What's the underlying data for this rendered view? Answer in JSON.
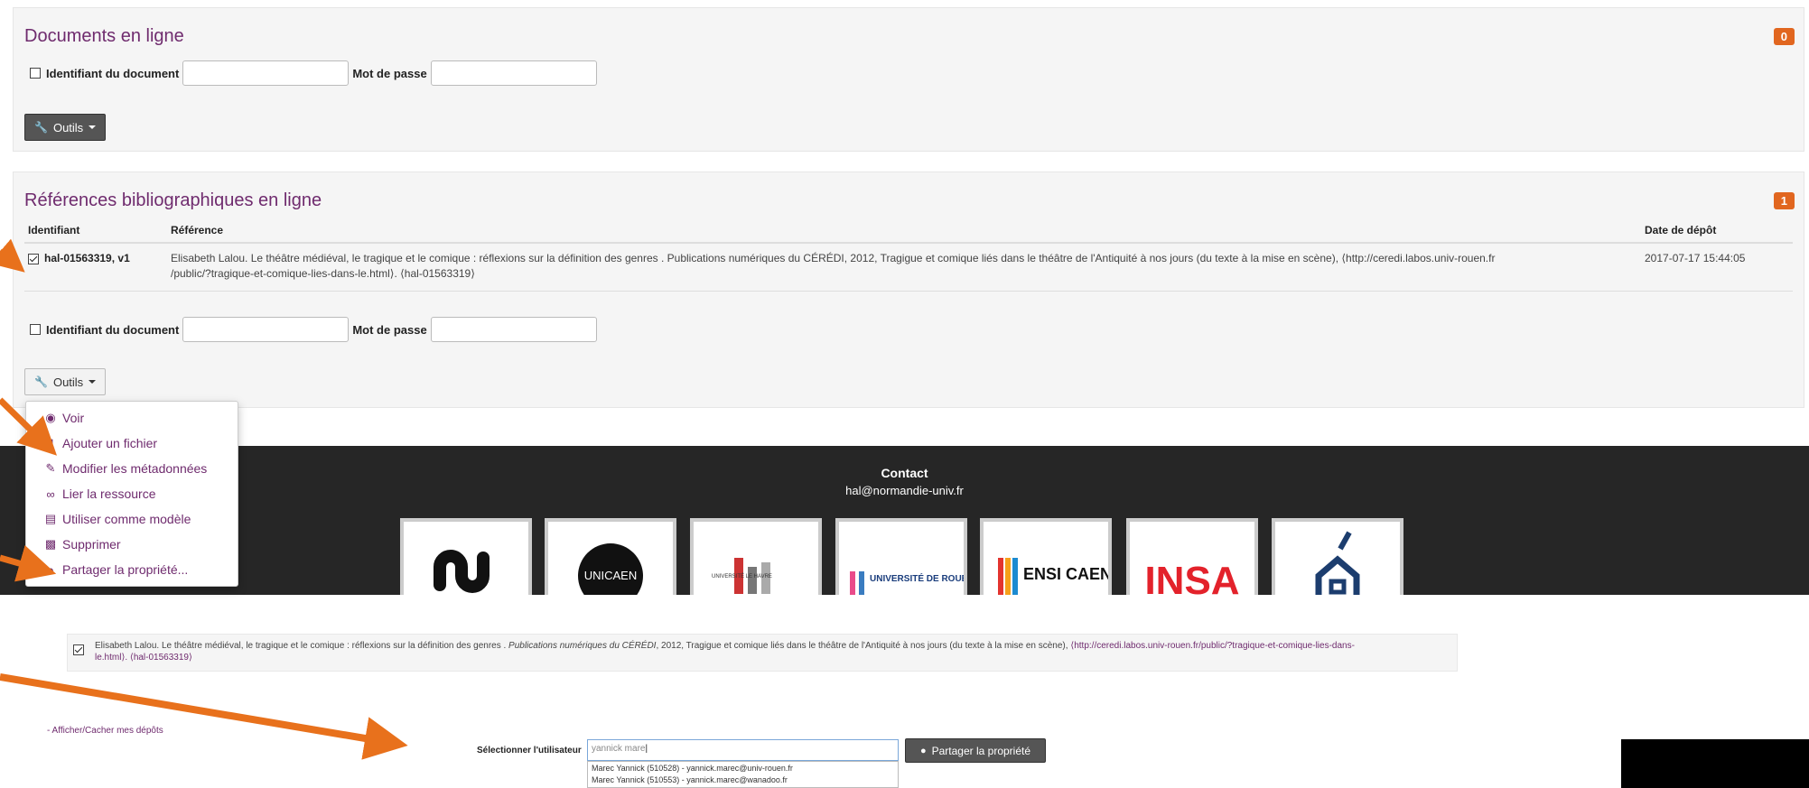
{
  "panel1": {
    "title": "Documents en ligne",
    "count": "0",
    "doc_id_label": "Identifiant du document",
    "password_label": "Mot de passe",
    "tools_label": "Outils"
  },
  "panel2": {
    "title": "Références bibliographiques en ligne",
    "count": "1",
    "columns": [
      "Identifiant",
      "Référence",
      "Date de dépôt"
    ],
    "row": {
      "id": "hal-01563319, v1",
      "reference_line1": "Elisabeth Lalou. Le théâtre médiéval, le tragique et le comique : réflexions sur la définition des genres . Publications numériques du CÉRÉDI, 2012, Tragigue et comique liés dans le théâtre de l'Antiquité à nos jours (du texte à la mise en scène), ⟨http://ceredi.labos.univ-rouen.fr",
      "reference_line2": "/public/?tragique-et-comique-lies-dans-le.html⟩. ⟨hal-01563319⟩",
      "date": "2017-07-17 15:44:05"
    },
    "doc_id_label": "Identifiant du document",
    "password_label": "Mot de passe",
    "tools_label": "Outils"
  },
  "menu": {
    "items": [
      {
        "label": "Voir",
        "icon": "eye-icon"
      },
      {
        "label": "Ajouter un fichier",
        "icon": "file-icon"
      },
      {
        "label": "Modifier les métadonnées",
        "icon": "pencil-icon"
      },
      {
        "label": "Lier la ressource",
        "icon": "link-icon"
      },
      {
        "label": "Utiliser comme modèle",
        "icon": "stamp-icon"
      },
      {
        "label": "Supprimer",
        "icon": "trash-icon"
      },
      {
        "label": "Partager la propriété...",
        "icon": "user-icon"
      }
    ]
  },
  "footer": {
    "contact_title": "Contact",
    "contact_email": "hal@normandie-univ.fr",
    "logos": [
      "UNICAEN",
      "UNIVERSITÉ LE HAVRE",
      "UNIVERSITÉ DE ROUEN",
      "ENSI CAEN",
      "INSA"
    ]
  },
  "share": {
    "reference_part1": "Elisabeth Lalou. Le théâtre médiéval, le tragique et le comique : réflexions sur la définition des genres . ",
    "reference_italic": "Publications numériques du CÉRÉDI",
    "reference_part2": ", 2012, Tragigue et comique liés dans le théâtre de l'Antiquité à nos jours (du texte à la mise en scène), ",
    "reference_link": "⟨http://ceredi.labos.univ-rouen.fr/public/?tragique-et-comique-lies-dans-",
    "reference_line2": "le.html⟩. ⟨hal-01563319⟩",
    "toggle_link": "- Afficher/Cacher mes dépôts",
    "select_user_label": "Sélectionner l'utilisateur",
    "select_user_value": "yannick mare",
    "share_button": "Partager la propriété",
    "suggestions": [
      "Marec Yannick (510528) - yannick.marec@univ-rouen.fr",
      "Marec Yannick (510553) - yannick.marec@wanadoo.fr"
    ]
  },
  "colors": {
    "accent": "#6f2b6e",
    "badge": "#e1661f",
    "arrow": "#e8711c",
    "footer_bg": "#262626"
  }
}
